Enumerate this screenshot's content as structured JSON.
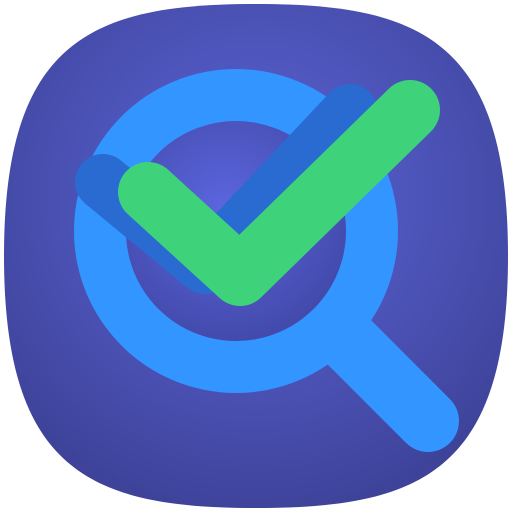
{
  "icon": {
    "name": "search-check-app-icon",
    "colors": {
      "background_dark": "#3b3f93",
      "background_mid": "#4a51b3",
      "background_light": "#5a64d8",
      "lens_ring": "#3395ff",
      "lens_shadow": "#2a6bd1",
      "handle": "#3395ff",
      "check": "#3ed27a",
      "check_shadow": "#2a6bd1"
    }
  }
}
